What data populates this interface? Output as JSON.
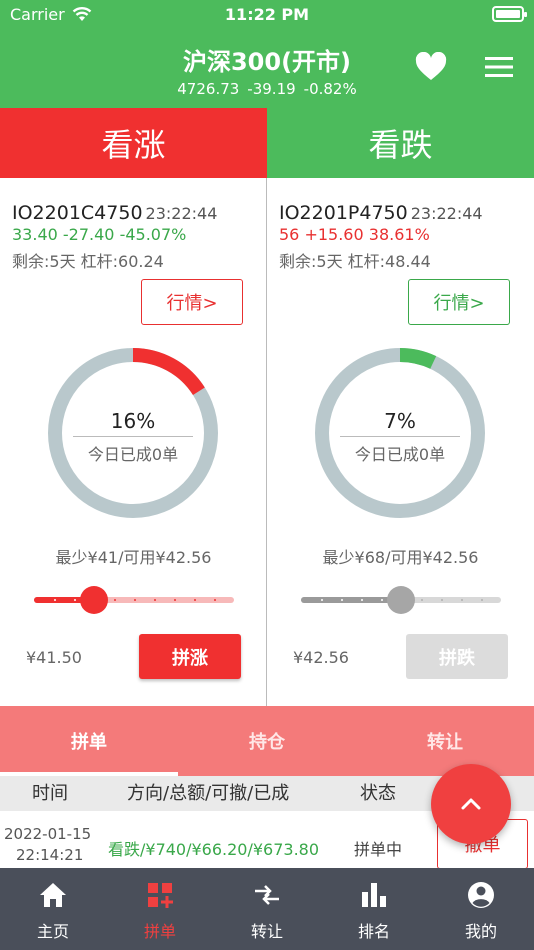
{
  "status_bar": {
    "carrier": "Carrier",
    "time": "11:22 PM"
  },
  "header": {
    "title": "沪深300(开市)",
    "index_value": "4726.73",
    "change": "-39.19",
    "change_pct": "-0.82%"
  },
  "direction": {
    "up_label": "看涨",
    "down_label": "看跌"
  },
  "call_option": {
    "code": "IO2201C4750",
    "time": "23:22:44",
    "price": "33.40",
    "change": "-27.40",
    "change_pct": "-45.07%",
    "remain": "剩余:5天 杠杆:60.24",
    "quote_label": "行情>",
    "progress_text": "16%",
    "progress_value": 0.16,
    "ring_sub": "今日已成0单",
    "min_available": "最少¥41/可用¥42.56",
    "slider_value": 0.3,
    "amount": "¥41.50",
    "action_label": "拼涨",
    "accent": "#f03030"
  },
  "put_option": {
    "code": "IO2201P4750",
    "time": "23:22:44",
    "price": "56",
    "change": "+15.60",
    "change_pct": "38.61%",
    "remain": "剩余:5天 杠杆:48.44",
    "quote_label": "行情>",
    "progress_text": "7%",
    "progress_value": 0.07,
    "ring_sub": "今日已成0单",
    "min_available": "最少¥68/可用¥42.56",
    "slider_value": 0.5,
    "amount": "¥42.56",
    "action_label": "拼跌",
    "accent": "#4cbb5c"
  },
  "tabs": [
    "拼单",
    "持仓",
    "转让"
  ],
  "table": {
    "headers": [
      "时间",
      "方向/总额/可撤/已成",
      "状态"
    ],
    "rows": [
      {
        "date": "2022-01-15",
        "time": "22:14:21",
        "detail": "看跌/¥740/¥66.20/¥673.80",
        "state": "拼单中",
        "action": "撤单"
      }
    ]
  },
  "bottom_nav": [
    {
      "label": "主页",
      "icon": "home-icon"
    },
    {
      "label": "拼单",
      "icon": "grid-plus-icon",
      "active": true
    },
    {
      "label": "转让",
      "icon": "transfer-arrows-icon"
    },
    {
      "label": "排名",
      "icon": "bar-chart-icon"
    },
    {
      "label": "我的",
      "icon": "user-circle-icon"
    }
  ],
  "colors": {
    "brand_green": "#4cbb5c",
    "brand_red": "#f03030",
    "tab_bar": "#f47a7a",
    "nav_bg": "#4a4f5a",
    "ring_track": "#b9c8cc"
  }
}
